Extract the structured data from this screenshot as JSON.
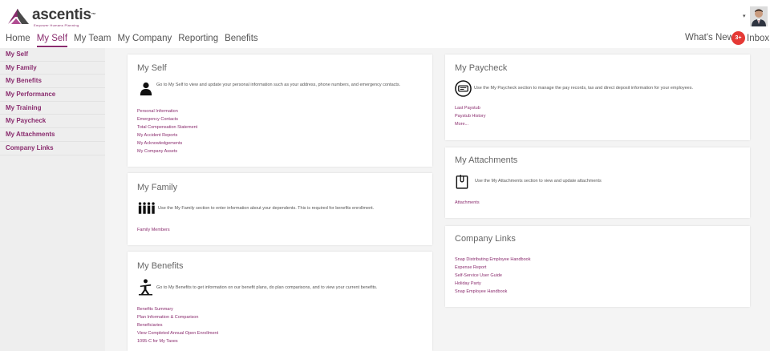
{
  "brand": {
    "name": "ascentis",
    "tagline": "Empower Humans Planning",
    "tm": "™",
    "color": "#8a2c6e"
  },
  "nav": [
    {
      "label": "Home"
    },
    {
      "label": "My Self",
      "active": true
    },
    {
      "label": "My Team"
    },
    {
      "label": "My Company"
    },
    {
      "label": "Reporting"
    },
    {
      "label": "Benefits"
    }
  ],
  "header": {
    "whats_new": "What's New",
    "inbox_badge": "3+",
    "inbox_label": "Inbox",
    "user_menu_caret": "▾"
  },
  "sidebar": [
    {
      "label": "My Self"
    },
    {
      "label": "My Family"
    },
    {
      "label": "My Benefits"
    },
    {
      "label": "My Performance"
    },
    {
      "label": "My Training"
    },
    {
      "label": "My Paycheck"
    },
    {
      "label": "My Attachments"
    },
    {
      "label": "Company Links"
    }
  ],
  "cards": {
    "my_self": {
      "title": "My Self",
      "icon": "person-icon",
      "description": "Go to My Self to view and update your personal information such as your address, phone numbers, and emergency contacts.",
      "links": [
        "Personal Information",
        "Emergency Contacts",
        "Total Compensation Statement",
        "My Accident Reports",
        "My Acknowledgements",
        "My Company Assets"
      ]
    },
    "my_family": {
      "title": "My Family",
      "icon": "family-icon",
      "description": "Use the My Family section to enter information about your dependents. This is required for benefits enrollment.",
      "links": [
        "Family Members"
      ]
    },
    "my_benefits": {
      "title": "My Benefits",
      "icon": "benefits-icon",
      "description": "Go to My Benefits to get information on our benefit plans, do plan comparisons, and to view your current benefits.",
      "links": [
        "Benefits Summary",
        "Plan Information & Comparison",
        "Beneficiaries",
        "View Completed Annual Open Enrollment",
        "1095-C for My Taxes"
      ]
    },
    "my_paycheck": {
      "title": "My Paycheck",
      "icon": "paycheck-icon",
      "description": "Use the My Paycheck section to manage the pay records, tax and direct deposit information for your employees.",
      "links": [
        "Last Paystub",
        "Paystub History",
        "More..."
      ]
    },
    "my_attachments": {
      "title": "My Attachments",
      "icon": "attachment-icon",
      "description": "Use the My Attachments section to view and update attachments",
      "links": [
        "Attachments"
      ]
    },
    "company_links": {
      "title": "Company Links",
      "links": [
        "Snap Distributing Employee Handbook",
        "Expense Report",
        "Self-Service User Guide",
        "Holiday Party",
        "Snap Employee Handbook"
      ]
    }
  }
}
